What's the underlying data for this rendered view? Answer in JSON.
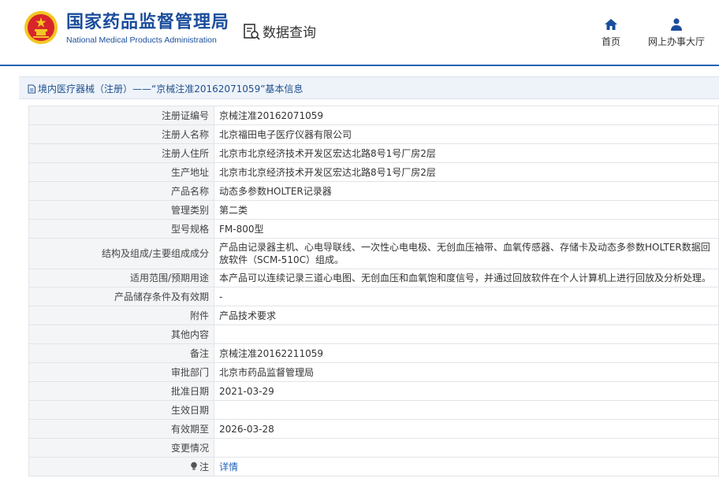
{
  "header": {
    "org_cn": "国家药品监督管理局",
    "org_en": "National Medical Products Administration",
    "query_label": "数据查询",
    "nav": [
      {
        "label": "首页",
        "icon": "home-icon"
      },
      {
        "label": "网上办事大厅",
        "icon": "user-icon"
      }
    ]
  },
  "breadcrumb": {
    "text": "境内医疗器械（注册）——“京械注准20162071059”基本信息",
    "icon": "document-icon"
  },
  "rows": [
    {
      "label": "注册证编号",
      "value": "京械注准20162071059"
    },
    {
      "label": "注册人名称",
      "value": "北京福田电子医疗仪器有限公司"
    },
    {
      "label": "注册人住所",
      "value": "北京市北京经济技术开发区宏达北路8号1号厂房2层"
    },
    {
      "label": "生产地址",
      "value": "北京市北京经济技术开发区宏达北路8号1号厂房2层"
    },
    {
      "label": "产品名称",
      "value": "动态多参数HOLTER记录器"
    },
    {
      "label": "管理类别",
      "value": "第二类"
    },
    {
      "label": "型号规格",
      "value": "FM-800型"
    },
    {
      "label": "结构及组成/主要组成成分",
      "value": "产品由记录器主机、心电导联线、一次性心电电极、无创血压袖带、血氧传感器、存储卡及动态多参数HOLTER数据回放软件（SCM-510C）组成。"
    },
    {
      "label": "适用范围/预期用途",
      "value": "本产品可以连续记录三道心电图、无创血压和血氧饱和度信号，并通过回放软件在个人计算机上进行回放及分析处理。"
    },
    {
      "label": "产品储存条件及有效期",
      "value": "-"
    },
    {
      "label": "附件",
      "value": "产品技术要求"
    },
    {
      "label": "其他内容",
      "value": ""
    },
    {
      "label": "备注",
      "value": "京械注准20162211059"
    },
    {
      "label": "审批部门",
      "value": "北京市药品监督管理局"
    },
    {
      "label": "批准日期",
      "value": "2021-03-29"
    },
    {
      "label": "生效日期",
      "value": ""
    },
    {
      "label": "有效期至",
      "value": "2026-03-28"
    },
    {
      "label": "变更情况",
      "value": ""
    }
  ],
  "note_row": {
    "label": "注",
    "icon": "lightbulb-icon",
    "link_text": "详情"
  },
  "colors": {
    "brand_blue": "#1a4d9c",
    "accent_blue": "#1f63b8",
    "emblem_red": "#d8252b",
    "emblem_gold": "#f3c623"
  }
}
